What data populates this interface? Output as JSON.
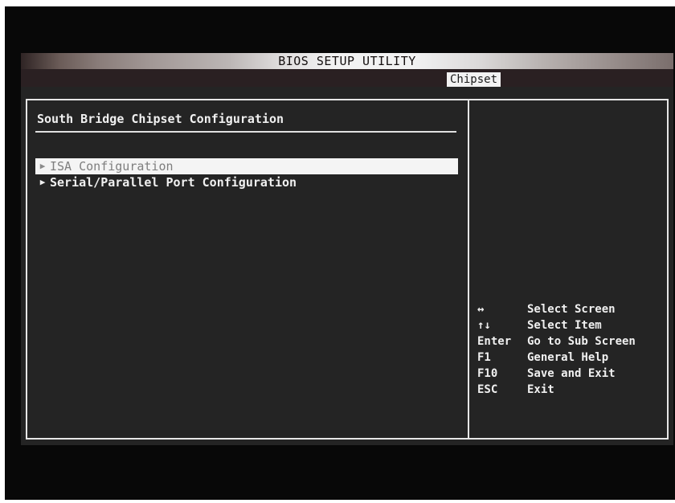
{
  "window": {
    "title": "BIOS SETUP UTILITY"
  },
  "tabs": {
    "active": "Chipset"
  },
  "main": {
    "section_title": "South Bridge Chipset Configuration",
    "items": [
      {
        "label": "ISA Configuration",
        "icon": "triangle-right-icon",
        "selected": true
      },
      {
        "label": "Serial/Parallel Port Configuration",
        "icon": "triangle-right-icon",
        "selected": false
      }
    ]
  },
  "help": [
    {
      "key": "↔",
      "desc": "Select Screen"
    },
    {
      "key": "↑↓",
      "desc": "Select Item"
    },
    {
      "key": "Enter",
      "desc": "Go to Sub Screen"
    },
    {
      "key": "F1",
      "desc": "General Help"
    },
    {
      "key": "F10",
      "desc": "Save and Exit"
    },
    {
      "key": "ESC",
      "desc": "Exit"
    }
  ],
  "colors": {
    "screen_bg": "#242424",
    "frame": "#e6e6e6",
    "highlight_bg": "#f4f4f4",
    "highlight_text": "#7e7e7e"
  }
}
